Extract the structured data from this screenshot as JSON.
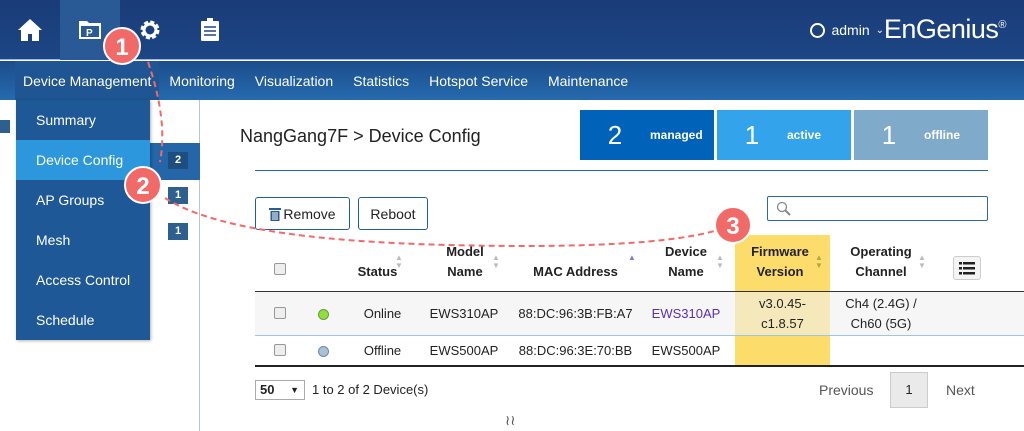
{
  "header": {
    "user": "admin",
    "brand": "EnGenius",
    "icons": [
      "home-icon",
      "project-folder-icon",
      "gear-icon",
      "clipboard-icon"
    ]
  },
  "nav": [
    "Device Management",
    "Monitoring",
    "Visualization",
    "Statistics",
    "Hotspot Service",
    "Maintenance"
  ],
  "menu": [
    "Summary",
    "Device Config",
    "AP Groups",
    "Mesh",
    "Access Control",
    "Schedule"
  ],
  "sidebar_badges": [
    "2",
    "1",
    "1"
  ],
  "page": {
    "title": "NangGang7F > Device Config"
  },
  "stats": [
    {
      "n": "2",
      "l": "managed",
      "color": "#0062b8"
    },
    {
      "n": "1",
      "l": "active",
      "color": "#33a3ec"
    },
    {
      "n": "1",
      "l": "offline",
      "color": "#7faac9"
    }
  ],
  "toolbar": {
    "remove": "Remove",
    "reboot": "Reboot",
    "search_placeholder": ""
  },
  "table": {
    "headers": [
      "Status",
      "Model\nName",
      "MAC Address",
      "Device\nName",
      "Firmware\nVersion",
      "Operating\nChannel"
    ],
    "rows": [
      {
        "status": "Online",
        "dot": "#8fe03a",
        "model": "EWS310AP",
        "mac": "88:DC:96:3B:FB:A7",
        "name": "EWS310AP",
        "fw1": "v3.0.45-",
        "fw2": "c1.8.57",
        "ch1": "Ch4 (2.4G) /",
        "ch2": "Ch60 (5G)"
      },
      {
        "status": "Offline",
        "dot": "#a9c0d6",
        "model": "EWS500AP",
        "mac": "88:DC:96:3E:70:BB",
        "name": "EWS500AP",
        "fw1": "",
        "fw2": "",
        "ch1": "",
        "ch2": ""
      }
    ]
  },
  "footer": {
    "page_size": "50",
    "summary": "1 to 2 of 2 Device(s)",
    "prev": "Previous",
    "page": "1",
    "next": "Next"
  },
  "annotations": [
    "1",
    "2",
    "3"
  ]
}
